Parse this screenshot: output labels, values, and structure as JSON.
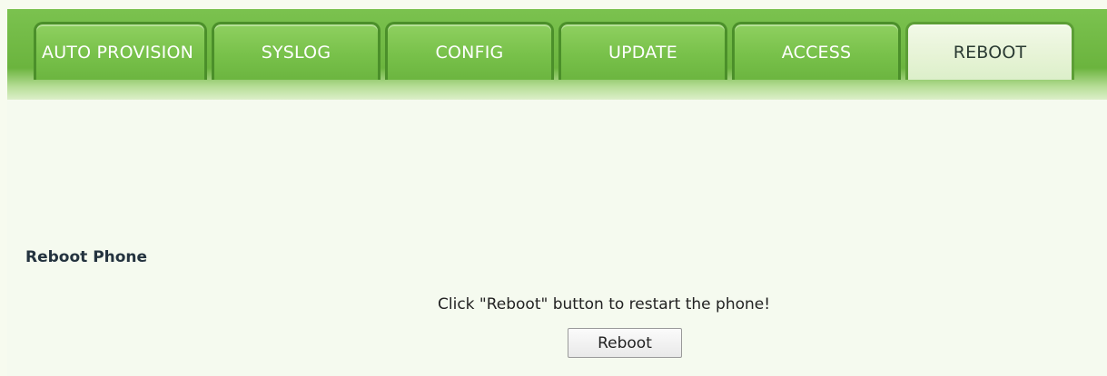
{
  "tabs": [
    {
      "label": "AUTO PROVISION",
      "active": false
    },
    {
      "label": "SYSLOG",
      "active": false
    },
    {
      "label": "CONFIG",
      "active": false
    },
    {
      "label": "UPDATE",
      "active": false
    },
    {
      "label": "ACCESS",
      "active": false
    },
    {
      "label": "REBOOT",
      "active": true
    }
  ],
  "section": {
    "title": "Reboot Phone",
    "message": "Click \"Reboot\" button to restart the phone!",
    "button_label": "Reboot"
  },
  "colors": {
    "header_green": "#6bb43e",
    "active_tab": "#e6f3d5",
    "content_bg": "#f5faef"
  }
}
